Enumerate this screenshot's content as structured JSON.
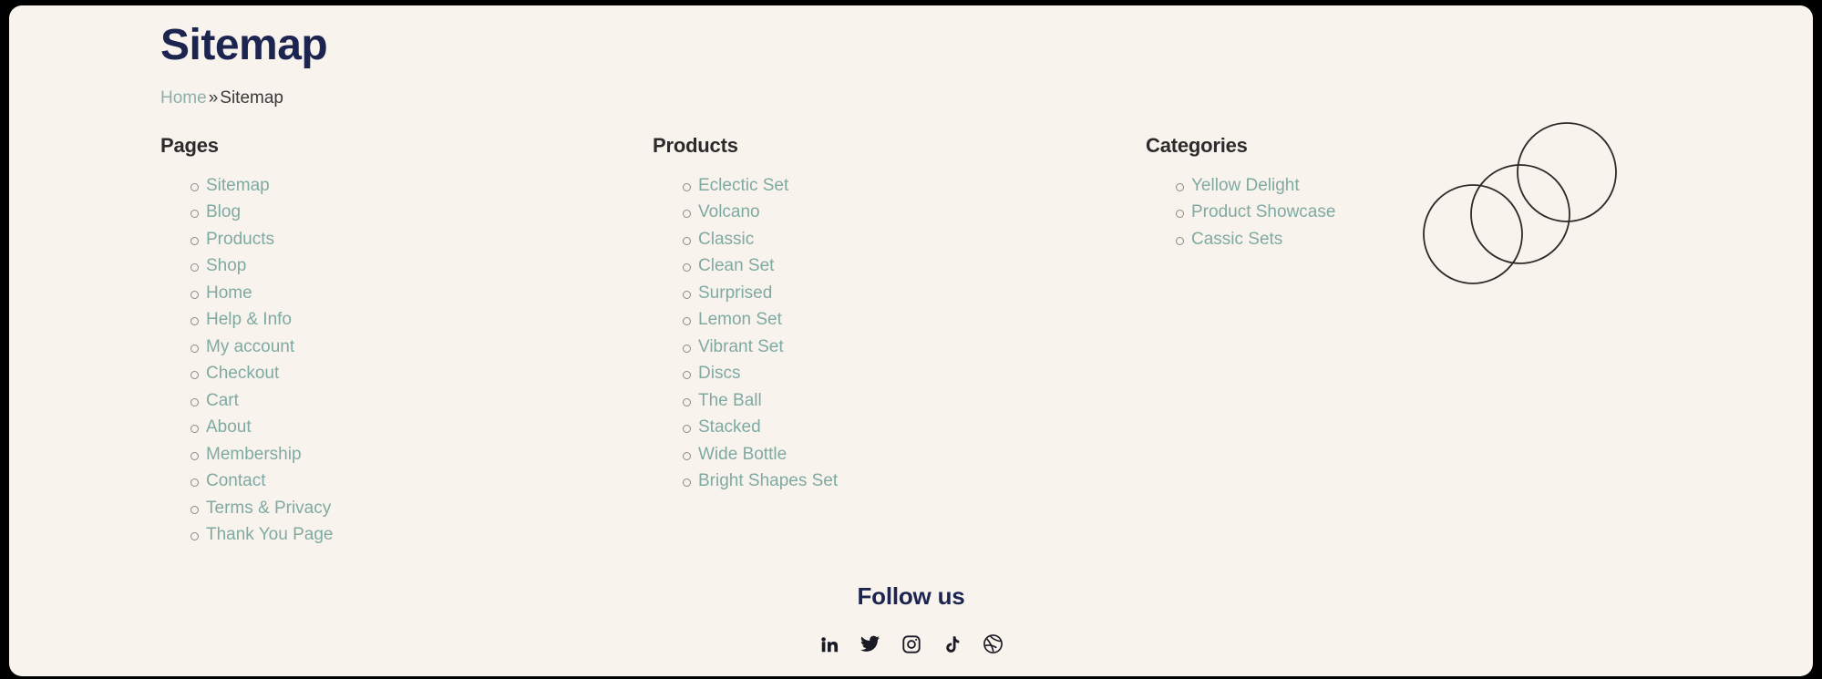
{
  "page": {
    "title": "Sitemap",
    "background_color": "#f9f3ee",
    "frame_color": "#000000",
    "heading_color": "#1c2450",
    "link_color": "#7faaa2",
    "text_color": "#2b2b2b"
  },
  "breadcrumb": {
    "home_label": "Home",
    "separator": "»",
    "current_label": "Sitemap"
  },
  "columns": {
    "pages": {
      "heading": "Pages",
      "items": [
        "Sitemap",
        "Blog",
        "Products",
        "Shop",
        "Home",
        "Help & Info",
        "My account",
        "Checkout",
        "Cart",
        "About",
        "Membership",
        "Contact",
        "Terms & Privacy",
        "Thank You Page"
      ]
    },
    "products": {
      "heading": "Products",
      "items": [
        "Eclectic Set",
        "Volcano",
        "Classic",
        "Clean Set",
        "Surprised",
        "Lemon Set",
        "Vibrant Set",
        "Discs",
        "The Ball",
        "Stacked",
        "Wide Bottle",
        "Bright Shapes Set"
      ]
    },
    "categories": {
      "heading": "Categories",
      "items": [
        "Yellow Delight",
        "Product Showcase",
        "Cassic Sets"
      ]
    }
  },
  "decoration": {
    "name": "three-overlapping-circles",
    "stroke_color": "#2e2a27",
    "circle_count": 3
  },
  "footer": {
    "follow_title": "Follow us",
    "social_links": [
      {
        "name": "linkedin-icon",
        "label": "LinkedIn"
      },
      {
        "name": "twitter-icon",
        "label": "Twitter"
      },
      {
        "name": "instagram-icon",
        "label": "Instagram"
      },
      {
        "name": "tiktok-icon",
        "label": "TikTok"
      },
      {
        "name": "dribbble-icon",
        "label": "Dribbble"
      }
    ]
  }
}
